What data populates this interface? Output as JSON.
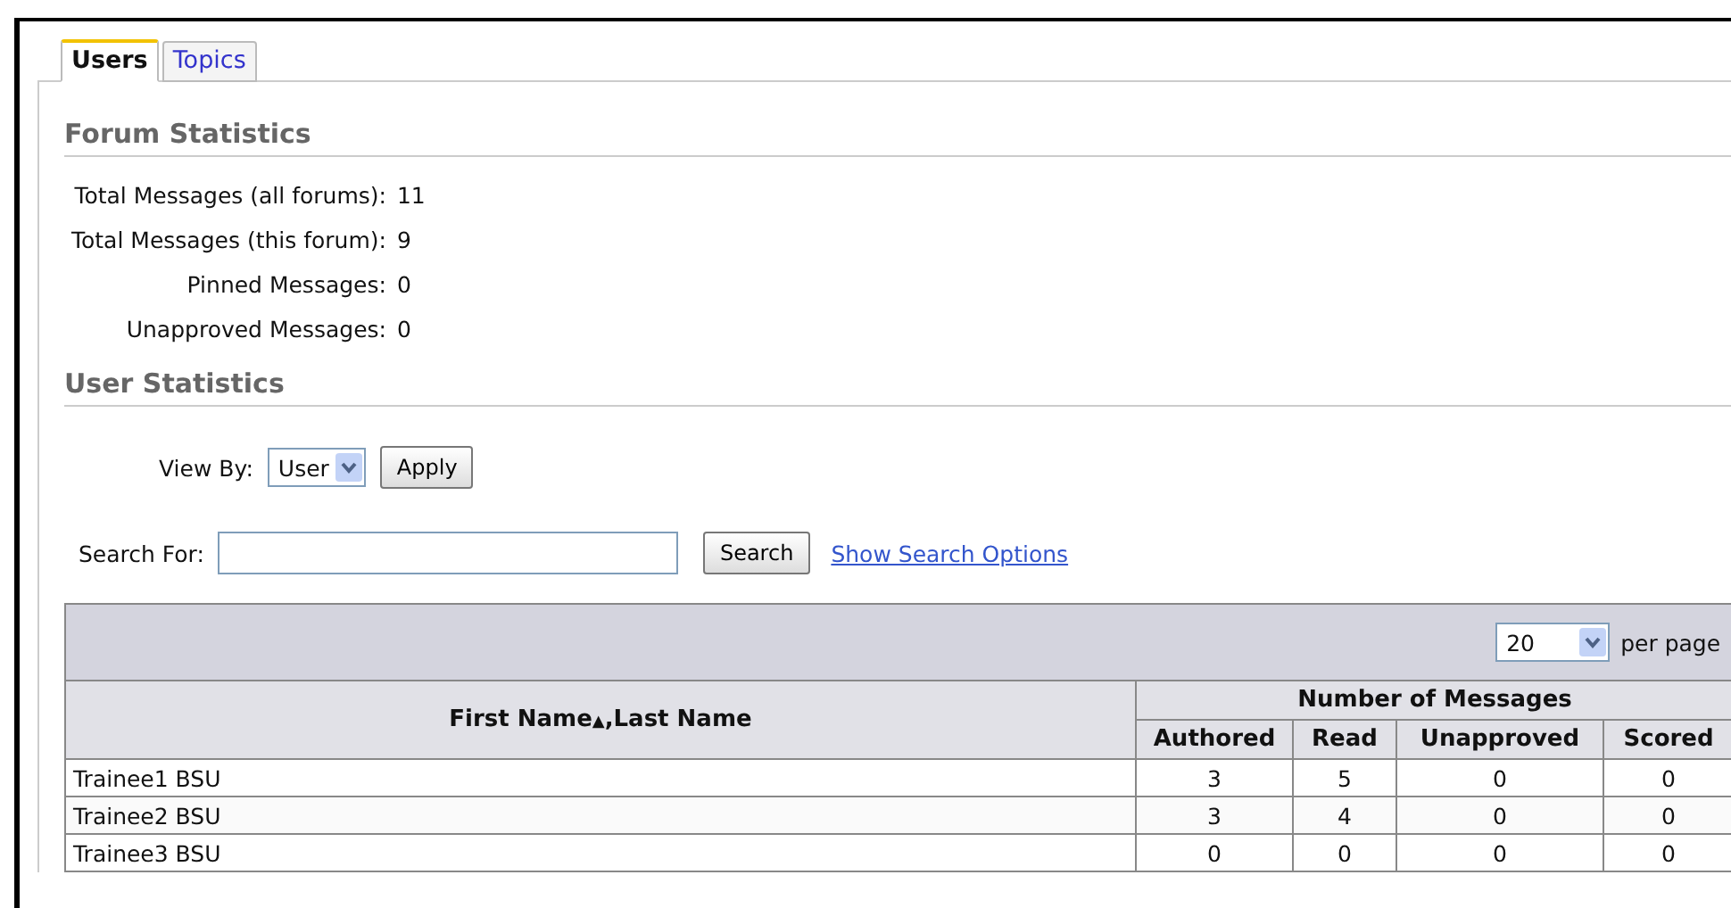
{
  "tabs": [
    {
      "label": "Users",
      "selected": true
    },
    {
      "label": "Topics",
      "selected": false
    }
  ],
  "forum_statistics": {
    "title": "Forum Statistics",
    "rows": [
      {
        "label": "Total Messages (all forums):",
        "value": "11"
      },
      {
        "label": "Total Messages (this forum):",
        "value": "9"
      },
      {
        "label": "Pinned Messages:",
        "value": "0"
      },
      {
        "label": "Unapproved Messages:",
        "value": "0"
      }
    ]
  },
  "user_statistics": {
    "title": "User Statistics",
    "view_by": {
      "label": "View By:",
      "value": "User",
      "button": "Apply"
    },
    "search": {
      "label": "Search For:",
      "button": "Search",
      "link": "Show Search Options"
    }
  },
  "table": {
    "per_page": {
      "value": "20",
      "label": "per page"
    },
    "name_column": {
      "label": "First Name",
      "sort_indicator": "▲",
      "label_2": ",Last Name"
    },
    "group_header": "Number of Messages",
    "columns": [
      "Authored",
      "Read",
      "Unapproved",
      "Scored"
    ],
    "rows": [
      {
        "name": "Trainee1 BSU",
        "values": [
          "3",
          "5",
          "0",
          "0"
        ]
      },
      {
        "name": "Trainee2 BSU",
        "values": [
          "3",
          "4",
          "0",
          "0"
        ]
      },
      {
        "name": "Trainee3 BSU",
        "values": [
          "0",
          "0",
          "0",
          "0"
        ]
      }
    ]
  }
}
